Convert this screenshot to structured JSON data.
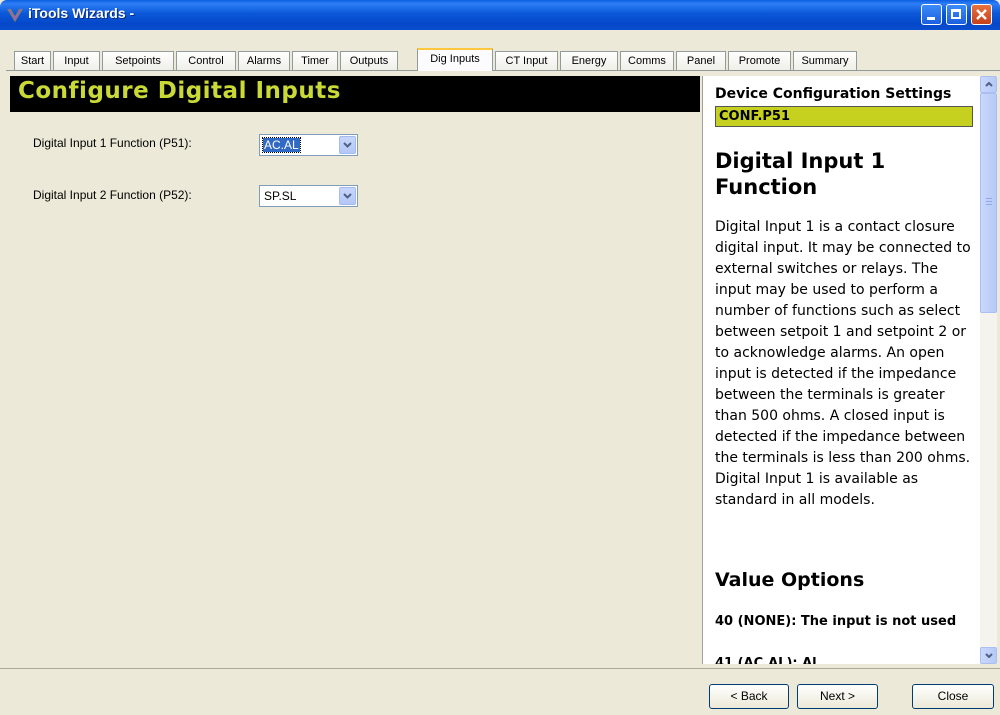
{
  "window": {
    "title": "iTools Wizards -"
  },
  "tabs": [
    "Start",
    "Input",
    "Setpoints",
    "Control",
    "Alarms",
    "Timer",
    "Outputs",
    "Dig Inputs",
    "CT Input",
    "Energy",
    "Comms",
    "Panel",
    "Promote",
    "Summary"
  ],
  "active_tab": "Dig Inputs",
  "main": {
    "title": "Configure Digital Inputs",
    "fields": [
      {
        "label": "Digital Input 1 Function (P51):",
        "value": "AC.AL"
      },
      {
        "label": "Digital Input 2 Function (P52):",
        "value": "SP.SL"
      }
    ]
  },
  "help": {
    "heading": "Device Configuration Settings",
    "code": "CONF.P51",
    "title": "Digital Input 1 Function",
    "body": "Digital Input 1 is a contact closure digital input. It may be connected to external switches or relays. The input may be used to perform a number of functions such as select between setpoit 1 and setpoint 2 or to acknowledge alarms. An open input is detected if the impedance between the terminals is greater than 500 ohms. A closed input is detected if the impedance between the terminals is less than 200 ohms. Digital Input 1 is available as standard in all models.",
    "subtitle": "Value Options",
    "option1": "40 (NONE): The input is not used",
    "option2_partial": "41 (AC.AL): Al..."
  },
  "buttons": {
    "back": "< Back",
    "next": "Next >",
    "close": "Close"
  }
}
